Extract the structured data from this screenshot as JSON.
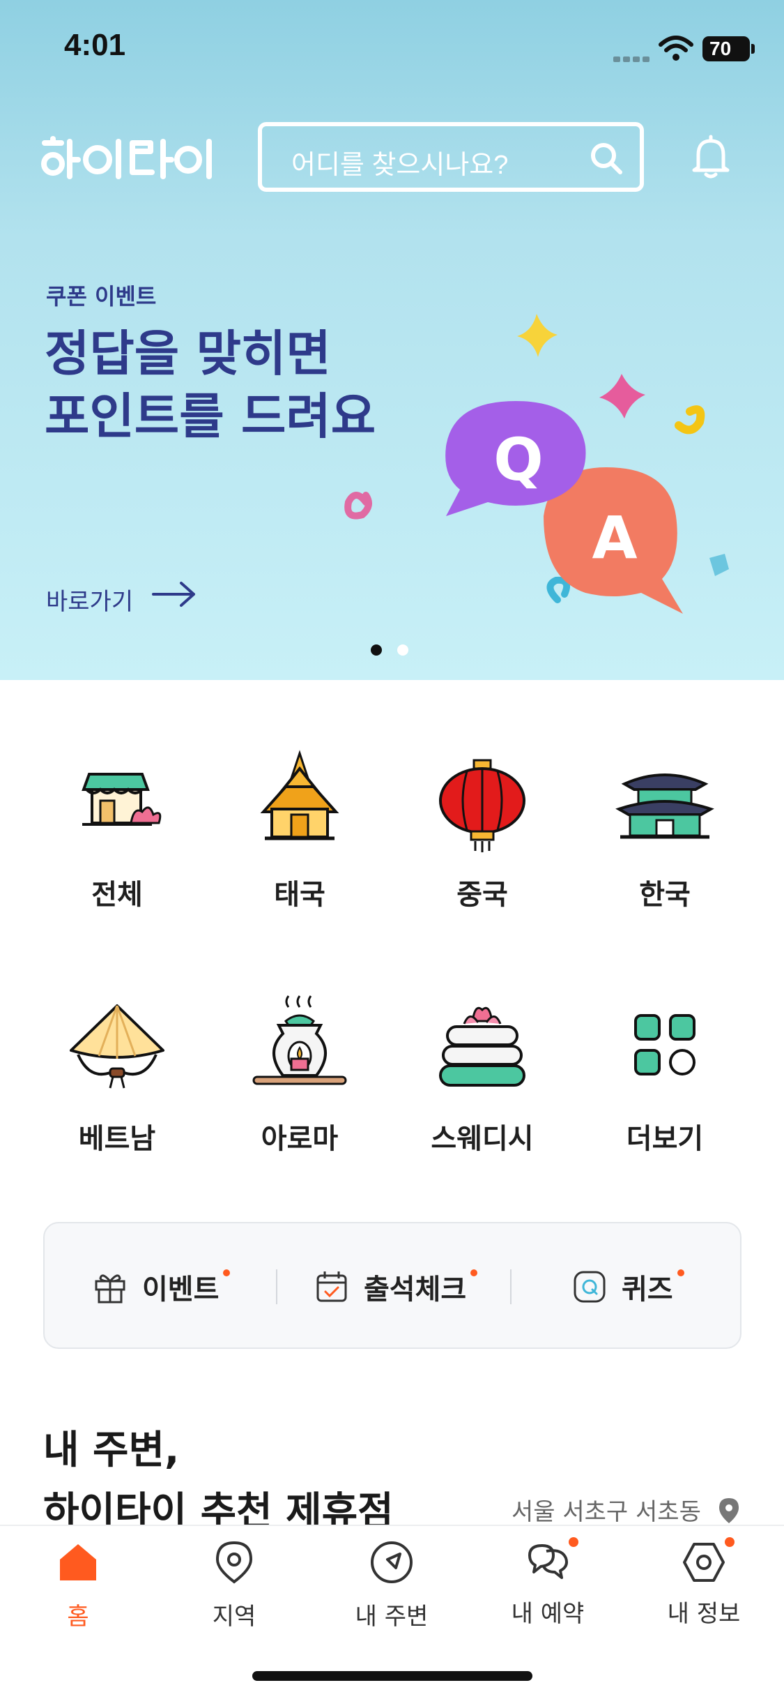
{
  "status_bar": {
    "time": "4:01",
    "battery": "70"
  },
  "header": {
    "logo_text": "하이타이",
    "search_placeholder": "어디를 찾으시나요?"
  },
  "banner": {
    "kicker": "쿠폰 이벤트",
    "headline": "정답을 맞히면\n포인트를 드려요",
    "cta": "바로가기",
    "art_letters": [
      "Q",
      "A"
    ],
    "page_count": 2,
    "active_page": 1
  },
  "categories": [
    {
      "label": "전체",
      "icon": "shop-lotus-icon"
    },
    {
      "label": "태국",
      "icon": "thai-temple-icon"
    },
    {
      "label": "중국",
      "icon": "chinese-lantern-icon"
    },
    {
      "label": "한국",
      "icon": "korean-palace-icon"
    },
    {
      "label": "베트남",
      "icon": "conical-hat-icon"
    },
    {
      "label": "아로마",
      "icon": "aroma-burner-icon"
    },
    {
      "label": "스웨디시",
      "icon": "towel-lotus-icon"
    },
    {
      "label": "더보기",
      "icon": "grid-more-icon"
    }
  ],
  "shortcuts": [
    {
      "label": "이벤트",
      "icon": "gift-icon"
    },
    {
      "label": "출석체크",
      "icon": "calendar-check-icon"
    },
    {
      "label": "퀴즈",
      "icon": "quiz-icon"
    }
  ],
  "section": {
    "title": "내 주변,\n하이타이 추천 제휴점",
    "location": "서울 서초구 서초동"
  },
  "tabbar": [
    {
      "label": "홈",
      "icon": "home-icon",
      "active": true,
      "badge": false
    },
    {
      "label": "지역",
      "icon": "map-pin-icon",
      "active": false,
      "badge": false
    },
    {
      "label": "내 주변",
      "icon": "navigation-icon",
      "active": false,
      "badge": false
    },
    {
      "label": "내 예약",
      "icon": "reservation-icon",
      "active": false,
      "badge": true
    },
    {
      "label": "내 정보",
      "icon": "profile-hexagon-icon",
      "active": false,
      "badge": true
    }
  ],
  "colors": {
    "accent": "#ff5a1f",
    "banner_text": "#2e3a8a",
    "mint": "#4cc7a0"
  }
}
